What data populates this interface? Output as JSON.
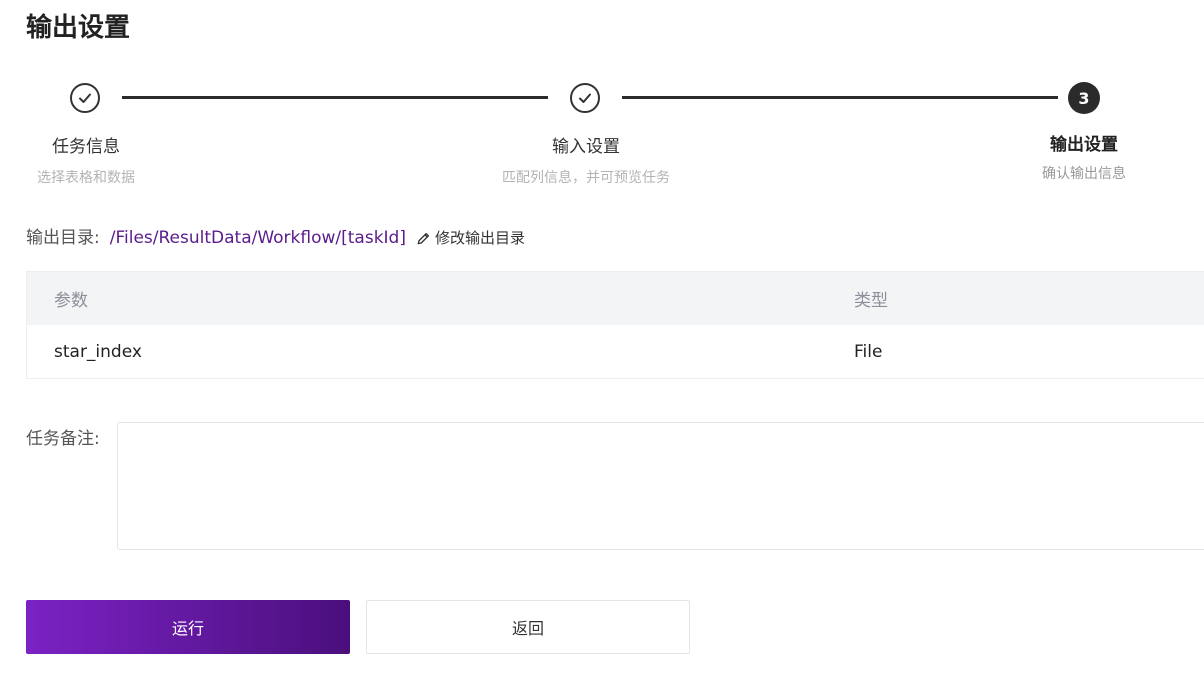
{
  "page": {
    "title": "输出设置"
  },
  "steps": [
    {
      "title": "任务信息",
      "desc": "选择表格和数据",
      "status": "done"
    },
    {
      "title": "输入设置",
      "desc": "匹配列信息，并可预览任务",
      "status": "done"
    },
    {
      "number": "3",
      "title": "输出设置",
      "desc": "确认输出信息",
      "status": "active"
    }
  ],
  "output_dir": {
    "label": "输出目录:",
    "path": "/Files/ResultData/Workflow/[taskId]",
    "edit_label": "修改输出目录"
  },
  "table": {
    "headers": {
      "param": "参数",
      "type": "类型"
    },
    "rows": [
      {
        "param": "star_index",
        "type": "File"
      }
    ]
  },
  "notes": {
    "label": "任务备注:",
    "value": ""
  },
  "buttons": {
    "run": "运行",
    "back": "返回"
  },
  "colors": {
    "accent": "#5a1c8c",
    "primary_gradient_start": "#7b22c4",
    "primary_gradient_end": "#4a0f7c"
  }
}
